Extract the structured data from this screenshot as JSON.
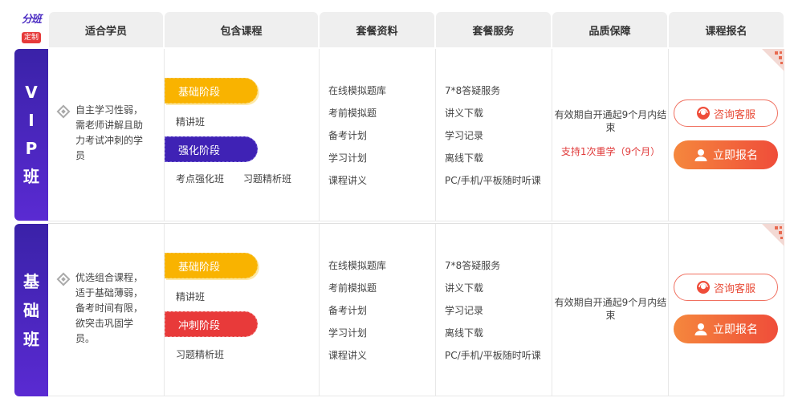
{
  "logo": {
    "line1": "分班",
    "line2": "定制"
  },
  "header": {
    "col1": "适合学员",
    "col2": "包含课程",
    "col3": "套餐资料",
    "col4": "套餐服务",
    "col5": "品质保障",
    "col6": "课程报名"
  },
  "rows": [
    {
      "label_chars": [
        "V",
        "I",
        "P",
        "班"
      ],
      "target": [
        "自主学习性弱，",
        "需老师讲解且助",
        "力考试冲刺的学",
        "员"
      ],
      "stage1": "基础阶段",
      "stage1_course": "精讲班",
      "stage2": "强化阶段",
      "stage2_course_a": "考点强化班",
      "stage2_course_b": "习题精析班",
      "materials": [
        "在线模拟题库",
        "考前模拟题",
        "备考计划",
        "学习计划",
        "课程讲义"
      ],
      "services": [
        "7*8答疑服务",
        "讲义下载",
        "学习记录",
        "离线下载",
        "PC/手机/平板随时听课"
      ],
      "quality_l1": "有效期自开通起9个月内结",
      "quality_l2": "束",
      "quality_red": "支持1次重学（9个月）",
      "consult": "咨询客服",
      "signup": "立即报名"
    },
    {
      "label_chars": [
        "基",
        "础",
        "班"
      ],
      "target": [
        "优选组合课程，",
        "适于基础薄弱，",
        "备考时间有限，",
        "欲突击巩固学",
        "员。"
      ],
      "stage1": "基础阶段",
      "stage1_course": "精讲班",
      "stage2": "冲刺阶段",
      "stage2_course_a": "习题精析班",
      "materials": [
        "在线模拟题库",
        "考前模拟题",
        "备考计划",
        "学习计划",
        "课程讲义"
      ],
      "services": [
        "7*8答疑服务",
        "讲义下载",
        "学习记录",
        "离线下载",
        "PC/手机/平板随时听课"
      ],
      "quality_l1": "有效期自开通起9个月内结",
      "quality_l2": "束",
      "consult": "咨询客服",
      "signup": "立即报名"
    }
  ],
  "colors": {
    "purple": "#3f22b5",
    "yellow": "#f9b300",
    "red": "#e83a3a",
    "orange": "#f5873d"
  }
}
